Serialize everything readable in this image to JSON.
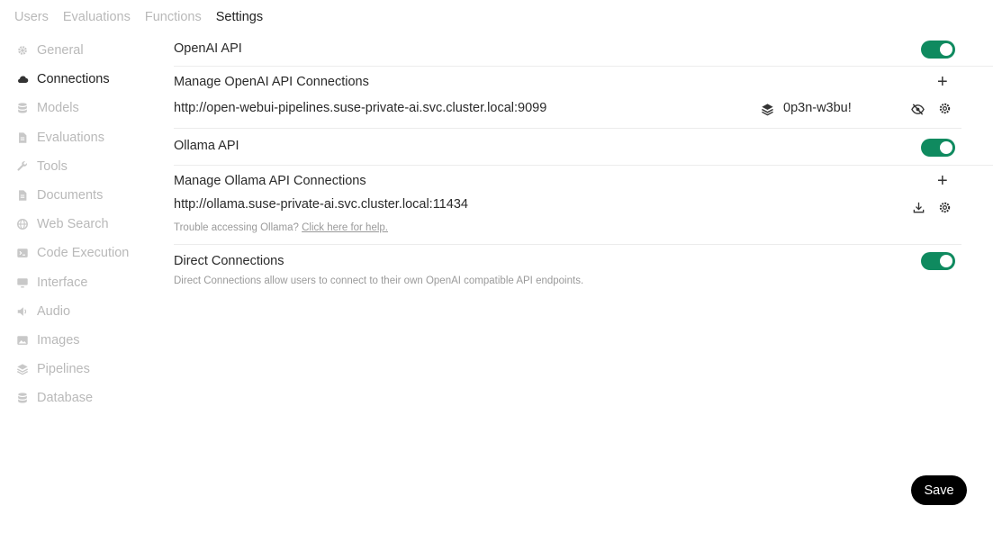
{
  "topnav": {
    "tabs": [
      "Users",
      "Evaluations",
      "Functions",
      "Settings"
    ],
    "active": "Settings"
  },
  "sidebar": {
    "items": [
      {
        "label": "General",
        "icon": "gear-icon"
      },
      {
        "label": "Connections",
        "icon": "cloud-icon"
      },
      {
        "label": "Models",
        "icon": "database-icon"
      },
      {
        "label": "Evaluations",
        "icon": "document-icon"
      },
      {
        "label": "Tools",
        "icon": "wrench-icon"
      },
      {
        "label": "Documents",
        "icon": "document-icon"
      },
      {
        "label": "Web Search",
        "icon": "globe-icon"
      },
      {
        "label": "Code Execution",
        "icon": "terminal-icon"
      },
      {
        "label": "Interface",
        "icon": "monitor-icon"
      },
      {
        "label": "Audio",
        "icon": "speaker-icon"
      },
      {
        "label": "Images",
        "icon": "image-icon"
      },
      {
        "label": "Pipelines",
        "icon": "layers-icon"
      },
      {
        "label": "Database",
        "icon": "database-icon"
      }
    ],
    "active": "Connections"
  },
  "openai": {
    "title": "OpenAI API",
    "enabled": true,
    "manage_title": "Manage OpenAI API Connections",
    "url": "http://open-webui-pipelines.suse-private-ai.svc.cluster.local:9099",
    "key": "0p3n-w3bu!"
  },
  "ollama": {
    "title": "Ollama API",
    "enabled": true,
    "manage_title": "Manage Ollama API Connections",
    "url": "http://ollama.suse-private-ai.svc.cluster.local:11434",
    "help_prefix": "Trouble accessing Ollama?",
    "help_link": "Click here for help."
  },
  "direct": {
    "title": "Direct Connections",
    "enabled": true,
    "description": "Direct Connections allow users to connect to their own OpenAI compatible API endpoints."
  },
  "save_label": "Save",
  "colors": {
    "toggle_on": "#0f8a5f",
    "muted": "#b9b9b9",
    "button": "#000000"
  }
}
